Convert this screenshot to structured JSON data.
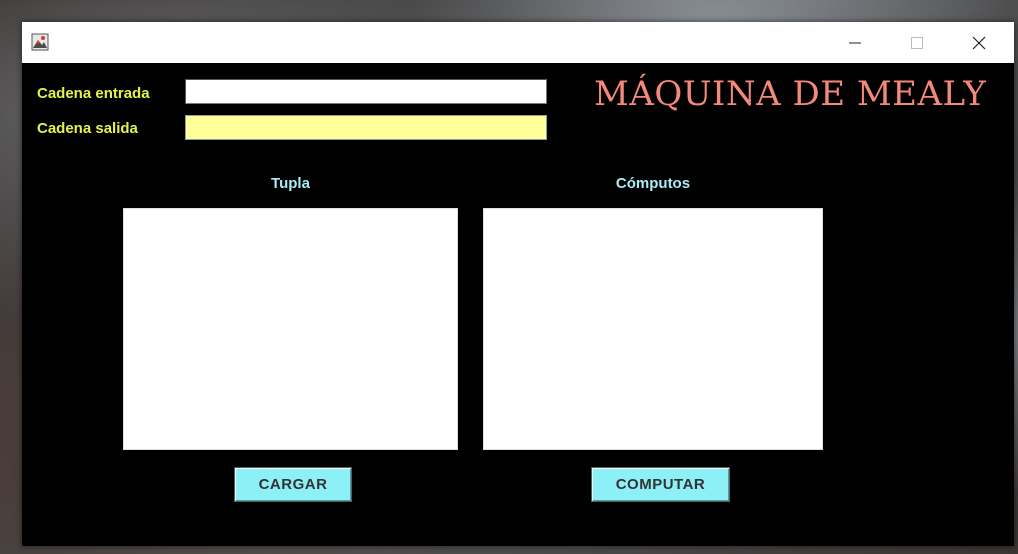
{
  "window": {
    "app_icon": "java-app-icon",
    "controls": {
      "minimize": "minimize-icon",
      "maximize": "maximize-icon",
      "close": "close-icon"
    }
  },
  "form": {
    "input_label": "Cadena entrada",
    "input_value": "",
    "output_label": "Cadena salida",
    "output_value": ""
  },
  "title": "MÁQUINA DE MEALY",
  "panels": {
    "tupla": {
      "heading": "Tupla",
      "content": ""
    },
    "computos": {
      "heading": "Cómputos",
      "content": ""
    }
  },
  "buttons": {
    "cargar": "CARGAR",
    "computar": "COMPUTAR"
  },
  "colors": {
    "window_bg": "#000000",
    "label": "#e3f34a",
    "title": "#f4897b",
    "heading": "#a8ecf7",
    "button_bg": "#8ef0f7",
    "output_field_bg": "#ffff99"
  }
}
